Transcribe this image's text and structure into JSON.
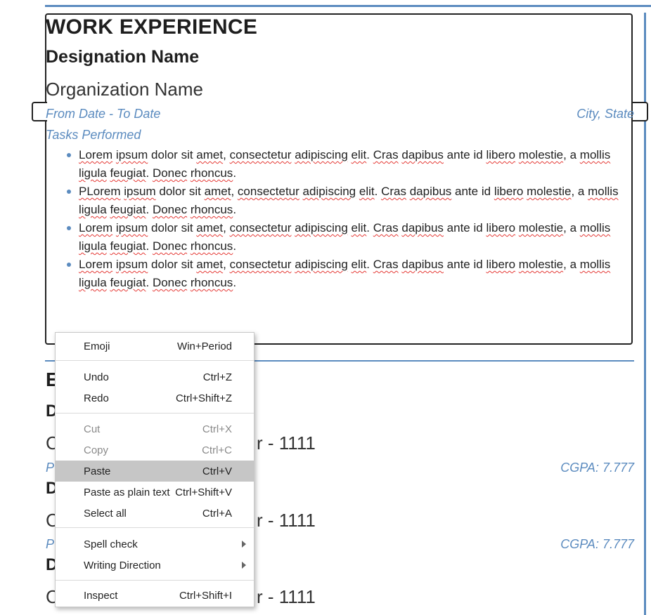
{
  "work": {
    "section_title": "WORK EXPERIENCE",
    "designation": "Designation Name",
    "organization": "Organization Name",
    "dates": "From Date - To Date",
    "location": "City, State",
    "tasks_label": "Tasks Performed",
    "tasks": [
      "Lorem ipsum dolor sit amet, consectetur adipiscing elit. Cras dapibus ante id libero molestie, a mollis ligula feugiat. Donec rhoncus.",
      "PLorem ipsum dolor sit amet, consectetur adipiscing elit. Cras dapibus ante id libero molestie, a mollis ligula feugiat. Donec rhoncus.",
      "Lorem ipsum dolor sit amet, consectetur adipiscing elit. Cras dapibus ante id libero molestie, a mollis ligula feugiat. Donec rhoncus.",
      "Lorem ipsum dolor sit amet, consectetur adipiscing elit. Cras dapibus ante id libero molestie, a mollis ligula feugiat. Donec rhoncus."
    ]
  },
  "education": {
    "section_fragment": "E",
    "entries": [
      {
        "degree_fragment": "D",
        "org_fragment": "C",
        "year_fragment": "r - 1111",
        "percent_fragment": "P",
        "cgpa": "CGPA: 7.777"
      },
      {
        "degree_fragment": "D",
        "org_fragment": "C",
        "year_fragment": "r - 1111",
        "percent_fragment": "P",
        "cgpa": "CGPA: 7.777"
      },
      {
        "degree_fragment": "D",
        "org_fragment": "C",
        "year_fragment": "r - 1111"
      }
    ]
  },
  "context_menu": {
    "emoji": {
      "label": "Emoji",
      "shortcut": "Win+Period"
    },
    "undo": {
      "label": "Undo",
      "shortcut": "Ctrl+Z"
    },
    "redo": {
      "label": "Redo",
      "shortcut": "Ctrl+Shift+Z"
    },
    "cut": {
      "label": "Cut",
      "shortcut": "Ctrl+X"
    },
    "copy": {
      "label": "Copy",
      "shortcut": "Ctrl+C"
    },
    "paste": {
      "label": "Paste",
      "shortcut": "Ctrl+V"
    },
    "paste_plain": {
      "label": "Paste as plain text",
      "shortcut": "Ctrl+Shift+V"
    },
    "select_all": {
      "label": "Select all",
      "shortcut": "Ctrl+A"
    },
    "spell_check": {
      "label": "Spell check"
    },
    "writing_direction": {
      "label": "Writing Direction"
    },
    "inspect": {
      "label": "Inspect",
      "shortcut": "Ctrl+Shift+I"
    }
  },
  "colors": {
    "accent": "#5b8bbf",
    "menu_highlight": "#c6c6c6",
    "spellcheck_underline": "#e53935"
  }
}
